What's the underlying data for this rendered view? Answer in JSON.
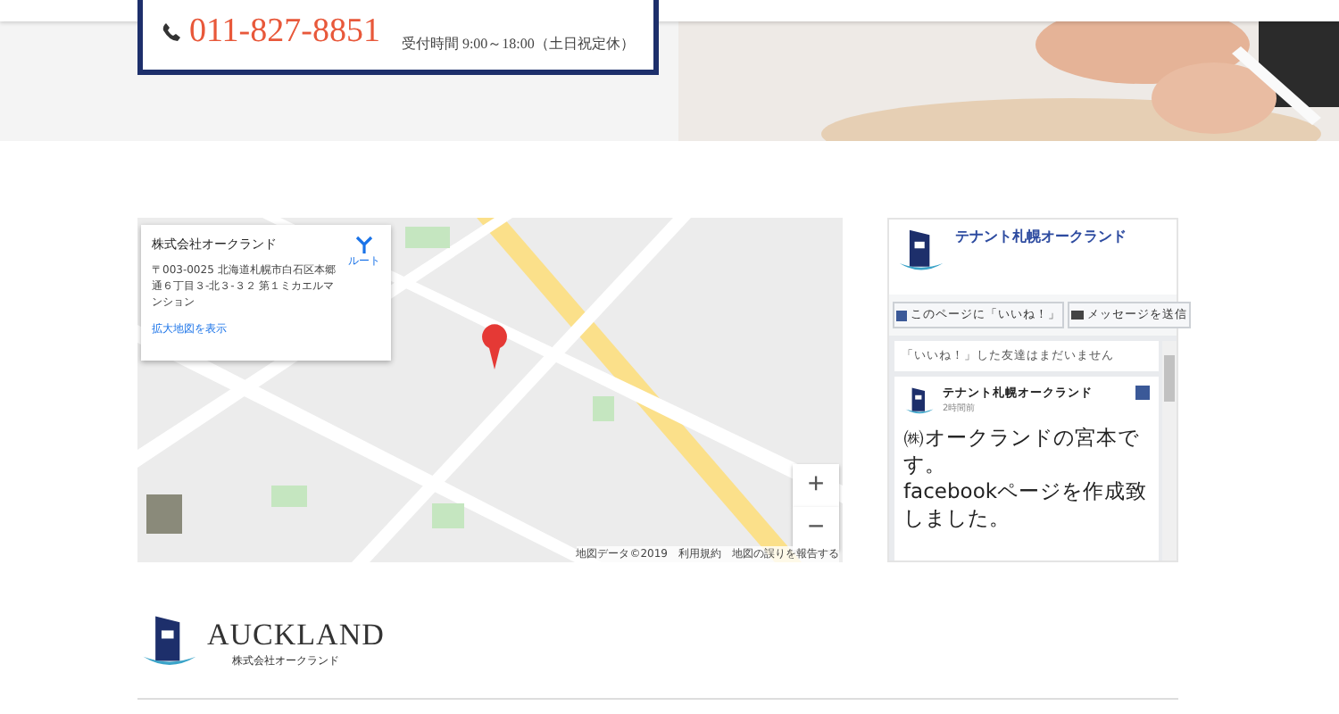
{
  "contact": {
    "phone": "011-827-8851",
    "hours": "受付時間 9:00～18:00（土日祝定休）"
  },
  "map": {
    "info": {
      "name": "株式会社オークランド",
      "address": "〒003-0025 北海道札幌市白石区本郷通６丁目３-北３-３２ 第１ミカエルマンション",
      "route": "ルート",
      "link": "拡大地図を表示"
    },
    "zoom_in": "+",
    "zoom_out": "−",
    "attribution": "地図データ©2019　利用規約　地図の誤りを報告する"
  },
  "facebook": {
    "page_name": "テナント札幌オークランド",
    "like_button": "このページに「いいね！」",
    "message_button": "メッセージを送信",
    "friends_note": "「いいね！」した友達はまだいません",
    "post": {
      "author": "テナント札幌オークランド",
      "time": "2時間前",
      "text": "㈱オークランドの宮本です。\nfacebookページを作成致しました。"
    }
  },
  "footer": {
    "brand": "AUCKLAND",
    "brand_sub": "株式会社オークランド"
  }
}
